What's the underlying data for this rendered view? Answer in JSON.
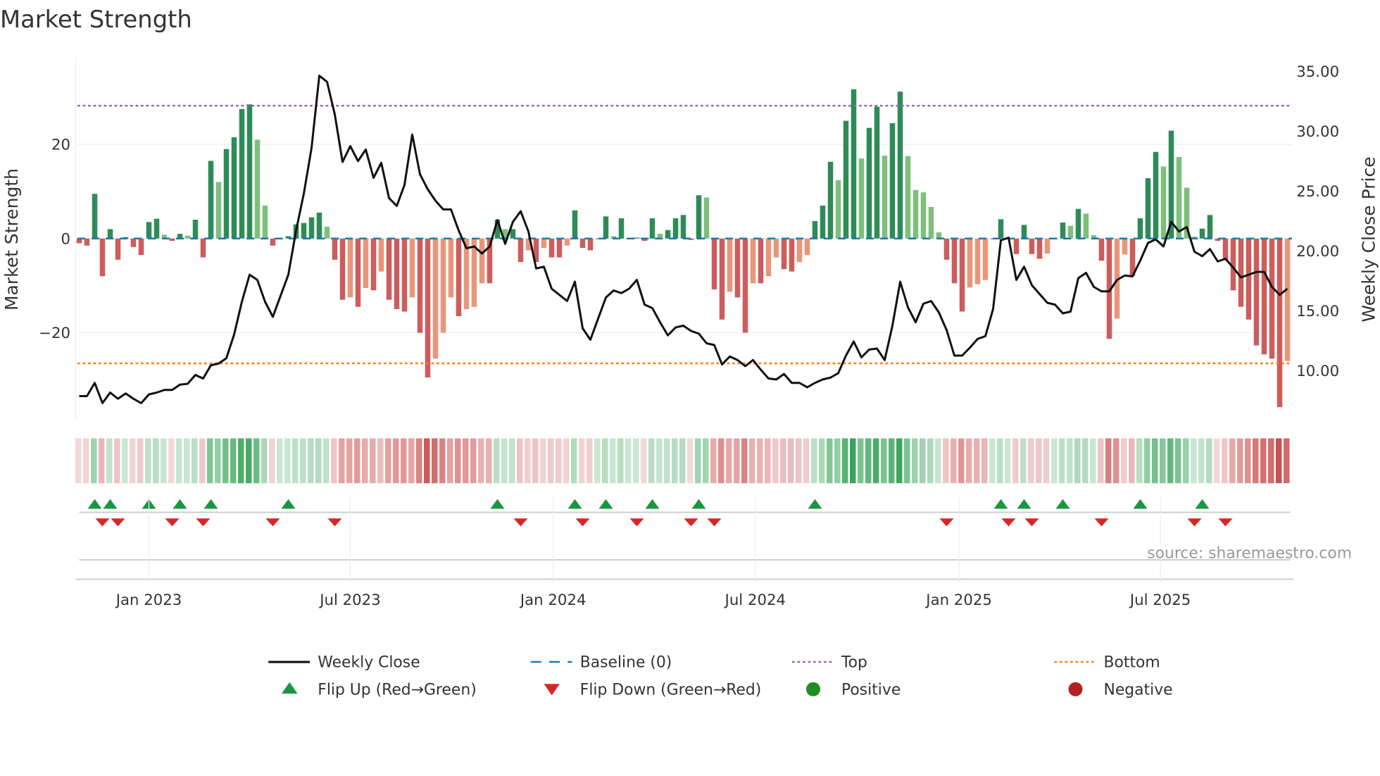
{
  "chart_data": {
    "type": "bar",
    "title": "Market Strength",
    "ylabel": "Market Strength",
    "y2label": "Weekly Close Price",
    "ylim": [
      -36,
      38.5
    ],
    "y2lim": [
      6.3,
      36
    ],
    "yticks": [
      {
        "v": 20,
        "label": "20"
      },
      {
        "v": 0,
        "label": "0"
      },
      {
        "v": -20,
        "label": "−20"
      }
    ],
    "y2ticks": [
      "35.00",
      "30.00",
      "25.00",
      "20.00",
      "15.00",
      "10.00"
    ],
    "xticks": [
      {
        "week": 9,
        "label": "Jan 2023"
      },
      {
        "week": 35,
        "label": "Jul 2023"
      },
      {
        "week": 61.2,
        "label": "Jan 2024"
      },
      {
        "week": 87.3,
        "label": "Jul 2024"
      },
      {
        "week": 113.6,
        "label": "Jan 2025"
      },
      {
        "week": 139.6,
        "label": "Jul 2025"
      }
    ],
    "top": 28.2,
    "bottom": -26.5,
    "baseline": 0,
    "strength": [
      -1,
      -1.5,
      9.5,
      -8,
      2,
      -4.5,
      0.3,
      -1.8,
      -3.5,
      3.5,
      4.2,
      0.8,
      -0.5,
      1,
      0.6,
      4,
      -4,
      16.5,
      12,
      19,
      21.5,
      27.5,
      28.5,
      21,
      7,
      -1.5,
      0,
      0.5,
      3,
      3.3,
      4.5,
      5.5,
      2.5,
      -4.5,
      -13,
      -12.5,
      -14.5,
      -10.5,
      -11,
      -7,
      -13,
      -15,
      -15.5,
      -12.5,
      -20,
      -29.5,
      -25.5,
      -20,
      -12.5,
      -16.5,
      -15,
      -14.5,
      -9.5,
      -9.5,
      4,
      2,
      2,
      -5,
      -2.5,
      -5,
      -2,
      -4,
      -4,
      -1.5,
      6,
      -2,
      -2.5,
      0,
      4.7,
      0.5,
      4.3,
      0,
      0.2,
      -0.5,
      4.3,
      1,
      1.8,
      4.3,
      5,
      -0.3,
      9.2,
      8.7,
      -10.8,
      -17.2,
      -11.3,
      -12.5,
      -20,
      -9.5,
      -9.5,
      -8,
      -4,
      -6.5,
      -7,
      -5,
      -3.5,
      3.7,
      7,
      16.3,
      12.4,
      25,
      31.7,
      17,
      23.5,
      28,
      17.6,
      24.5,
      31.2,
      17.5,
      10.3,
      9.8,
      6.7,
      1.3,
      -4.5,
      -9.5,
      -15.5,
      -10.4,
      -9.7,
      -8.8,
      0,
      4.1,
      0,
      -3.3,
      2.9,
      -3.3,
      -4.3,
      -3.2,
      0,
      3.4,
      2.7,
      6.3,
      5.3,
      0.7,
      -4.7,
      -21.3,
      -17,
      -3.4,
      -7.9,
      4.3,
      12.8,
      18.4,
      15.3,
      22.9,
      17.3,
      10.8,
      0.4,
      2.1,
      5,
      -0.5,
      -4.6,
      -11,
      -14.5,
      -17.2,
      -22.7,
      -24.6,
      -25.5,
      -35.8,
      -26
    ],
    "weekly_close": [
      7.87,
      7.87,
      8.97,
      7.28,
      8.16,
      7.65,
      8.09,
      7.65,
      7.28,
      8.01,
      8.16,
      8.38,
      8.38,
      8.82,
      8.9,
      9.63,
      9.34,
      10.44,
      10.59,
      11.03,
      13.01,
      15.74,
      18.01,
      17.57,
      15.74,
      14.49,
      16.25,
      18.01,
      21.69,
      24.78,
      28.6,
      34.63,
      34.12,
      31.4,
      27.43,
      28.75,
      27.5,
      28.46,
      26.1,
      27.35,
      24.41,
      23.75,
      25.51,
      29.71,
      26.4,
      25.15,
      24.19,
      23.46,
      23.46,
      21.69,
      20.22,
      20.37,
      19.78,
      20.37,
      22.57,
      20.59,
      22.43,
      23.31,
      21.62,
      18.53,
      18.68,
      16.84,
      16.32,
      15.81,
      17.43,
      13.53,
      12.57,
      14.34,
      16.1,
      16.69,
      16.47,
      16.84,
      17.57,
      15.51,
      15.22,
      14.04,
      12.94,
      13.6,
      13.75,
      13.31,
      13.09,
      12.28,
      12.13,
      10.51,
      11.18,
      10.88,
      10.37,
      10.88,
      10.07,
      9.34,
      9.26,
      9.71,
      8.97,
      8.97,
      8.6,
      8.97,
      9.26,
      9.41,
      9.78,
      11.25,
      12.43,
      11.1,
      11.76,
      11.84,
      10.88,
      13.75,
      17.43,
      15.29,
      14.04,
      15.59,
      15.81,
      14.85,
      13.38,
      11.25,
      11.25,
      11.91,
      12.65,
      12.87,
      15.15,
      20.88,
      21.1,
      17.57,
      18.68,
      17.13,
      16.4,
      15.66,
      15.51,
      14.78,
      14.93,
      17.72,
      18.16,
      16.99,
      16.62,
      16.62,
      17.57,
      17.94,
      17.87,
      19.19,
      20.66,
      20.96,
      20.37,
      22.43,
      21.62,
      21.99,
      19.93,
      19.56,
      20.15,
      19.12,
      19.34,
      18.6,
      17.79,
      18.01,
      18.24,
      18.24,
      16.99,
      16.32,
      16.84
    ],
    "flip_up_weeks": [
      2,
      4,
      9,
      13,
      17,
      27,
      54,
      64,
      68,
      74,
      80,
      95,
      119,
      122,
      127,
      137,
      145
    ],
    "flip_down_weeks": [
      3,
      5,
      12,
      16,
      25,
      33,
      57,
      65,
      72,
      79,
      82,
      112,
      120,
      123,
      132,
      144,
      148
    ],
    "legend": [
      {
        "label": "Weekly Close",
        "kind": "line",
        "color": "#111111"
      },
      {
        "label": "Baseline (0)",
        "kind": "dash",
        "color": "#1f77b4"
      },
      {
        "label": "Top",
        "kind": "dot",
        "color": "#9467bd"
      },
      {
        "label": "Bottom",
        "kind": "dot",
        "color": "#ff7f0e"
      },
      {
        "label": "Flip Up (Red→Green)",
        "kind": "tri-up",
        "color": "#1a9641"
      },
      {
        "label": "Flip Down (Green→Red)",
        "kind": "tri-down",
        "color": "#d62728"
      },
      {
        "label": "Positive",
        "kind": "circle",
        "color": "#228b22"
      },
      {
        "label": "Negative",
        "kind": "circle",
        "color": "#b22222"
      }
    ],
    "legend_placement": "bottom",
    "annotation": "source: sharemaestro.com"
  }
}
